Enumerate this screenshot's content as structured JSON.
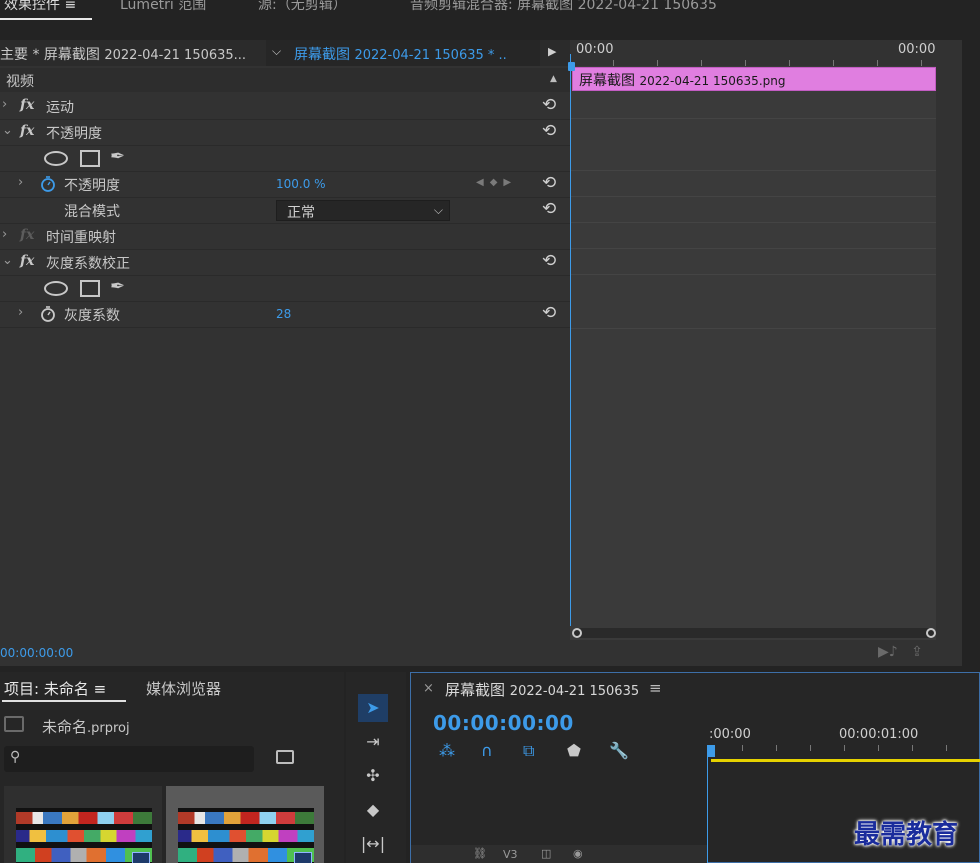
{
  "top_tabs": [
    {
      "label": "效果控件",
      "menu": "≡",
      "active": true
    },
    {
      "label": "Lumetri 范围"
    },
    {
      "label": "源:（无剪辑）"
    },
    {
      "label": "音频剪辑混合器: 屏幕截图 2022-04-21 150635"
    }
  ],
  "effect_controls": {
    "master_clip": "主要 * 屏幕截图",
    "master_clip_suffix": "2022-04-21 150635...",
    "sequence_clip": "屏幕截图",
    "sequence_clip_suffix": "2022-04-21 150635 * ..",
    "section_label": "视频",
    "effects": {
      "motion": "运动",
      "opacity": "不透明度",
      "opacity_param": "不透明度",
      "opacity_value": "100.0 %",
      "blend_mode_label": "混合模式",
      "blend_mode_value": "正常",
      "time_remap": "时间重映射",
      "gamma": "灰度系数校正",
      "gamma_param": "灰度系数",
      "gamma_value": "28"
    },
    "ruler_start": "00:00",
    "ruler_end": "00:00",
    "clip_name": "屏幕截图",
    "clip_name_suffix": "2022-04-21  150635.png",
    "timecode": "00:00:00:00"
  },
  "project": {
    "tab_label": "项目: 未命名",
    "tab_menu": "≡",
    "media_tab": "媒体浏览器",
    "file_name": "未命名",
    "file_ext": ".prproj"
  },
  "sequence": {
    "close": "×",
    "title": "屏幕截图",
    "title_suffix": "2022-04-21 150635",
    "menu": "≡",
    "timecode": "00:00:00:00",
    "ruler_start": ":00:00",
    "ruler_mark": "00:00:01:00",
    "track_label": "V3"
  },
  "watermark": "最需教育",
  "colors": {
    "accent_blue": "#3d9be9",
    "clip_pink": "#e07ee0",
    "work_area_yellow": "#e6d200"
  },
  "icons": [
    "fx-icon",
    "reset-icon",
    "stopwatch-icon",
    "ellipse-mask-icon",
    "rectangle-mask-icon",
    "pen-mask-icon",
    "selection-tool-icon",
    "track-select-icon",
    "ripple-edit-icon",
    "razor-icon",
    "slip-icon",
    "snap-icon",
    "linked-selection-icon",
    "marker-icon",
    "wrench-icon"
  ]
}
